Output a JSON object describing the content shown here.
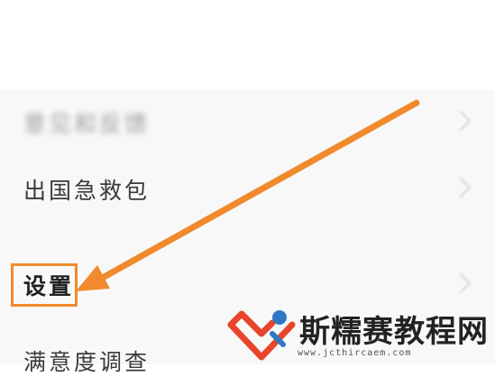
{
  "menu": {
    "items": [
      {
        "label": "意见和反馈",
        "blurred": true
      },
      {
        "label": "出国急救包"
      },
      {
        "label": "设置",
        "highlighted": true
      },
      {
        "label": "满意度调查"
      }
    ]
  },
  "annotation": {
    "arrow_color": "#f08a2c",
    "highlight_color": "#f08a2c"
  },
  "watermark": {
    "brand": "斯糯赛教程网",
    "url": "www.jcthircaem.com",
    "logo_icon": "heart-logo-icon",
    "logo_colors": [
      "#e8452c",
      "#2f79c4"
    ]
  }
}
